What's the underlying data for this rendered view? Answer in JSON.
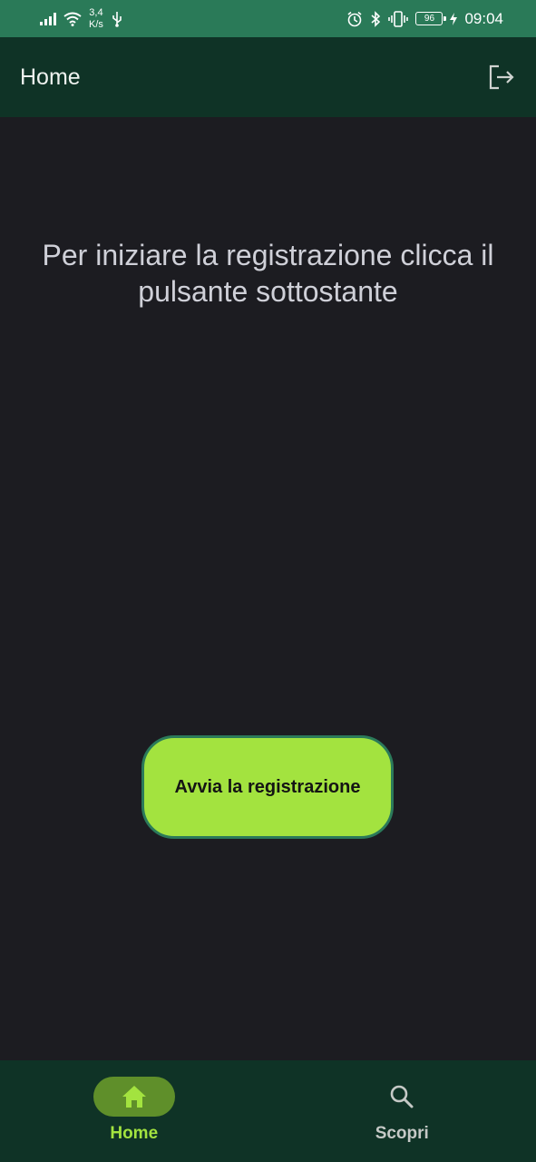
{
  "status_bar": {
    "net_speed_value": "3,4",
    "net_speed_unit": "K/s",
    "battery_level": "96",
    "time": "09:04"
  },
  "app_bar": {
    "title": "Home",
    "logout_icon": "logout-icon"
  },
  "main": {
    "prompt": "Per iniziare la registrazione clicca il pulsante sottostante",
    "start_button_label": "Avvia la registrazione"
  },
  "bottom_nav": {
    "items": [
      {
        "label": "Home",
        "icon": "home-icon",
        "active": true
      },
      {
        "label": "Scopri",
        "icon": "search-icon",
        "active": false
      }
    ]
  },
  "colors": {
    "status_bar": "#2a7a58",
    "app_bar": "#0f3326",
    "background": "#1c1c21",
    "accent": "#a3e33f",
    "button_border": "#2b7a5a",
    "active_pill": "#5f8f2a"
  }
}
